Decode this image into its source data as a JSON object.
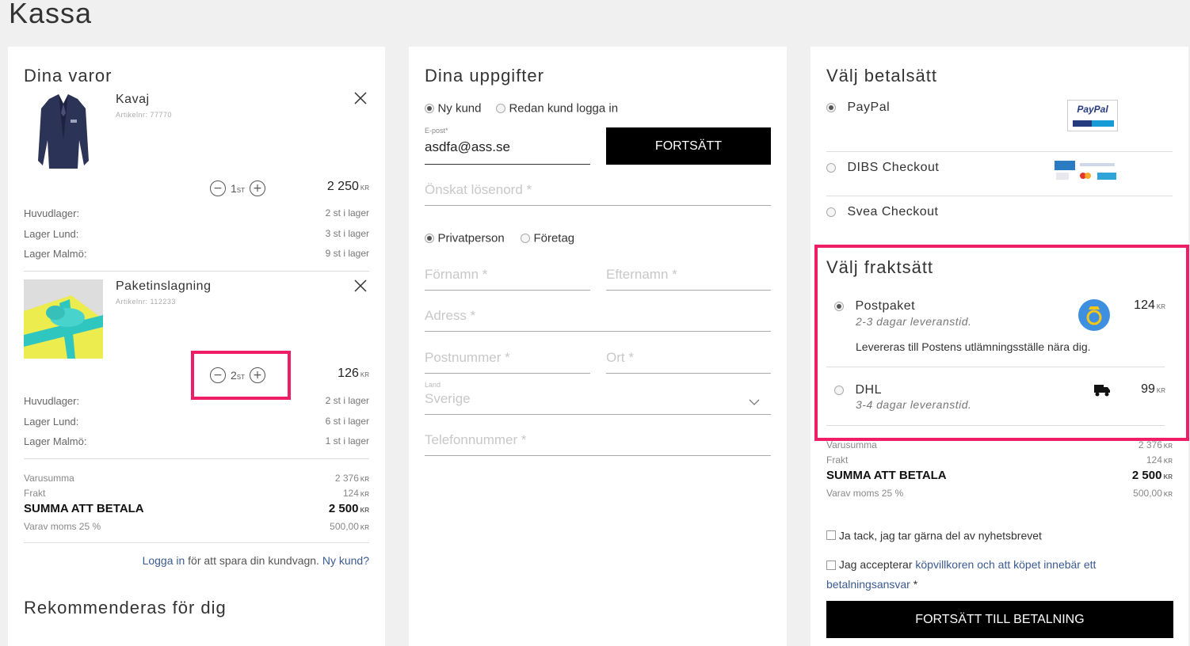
{
  "page_title": "Kassa",
  "cart": {
    "title": "Dina varor",
    "items": [
      {
        "name": "Kavaj",
        "article": "Artikelnr: 77770",
        "qty": "1",
        "qty_unit": "ST",
        "price": "2 250",
        "currency": "KR",
        "stock": [
          {
            "label": "Huvudlager:",
            "value": "2 st i lager"
          },
          {
            "label": "Lager Lund:",
            "value": "3 st i lager"
          },
          {
            "label": "Lager Malmö:",
            "value": "9 st i lager"
          }
        ]
      },
      {
        "name": "Paketinslagning",
        "article": "Artikelnr: 112233",
        "qty": "2",
        "qty_unit": "ST",
        "price": "126",
        "currency": "KR",
        "stock": [
          {
            "label": "Huvudlager:",
            "value": "2 st i lager"
          },
          {
            "label": "Lager Lund:",
            "value": "6 st i lager"
          },
          {
            "label": "Lager Malmö:",
            "value": "1 st i lager"
          }
        ]
      }
    ],
    "summary": {
      "varusumma_label": "Varusumma",
      "varusumma": "2 376",
      "frakt_label": "Frakt",
      "frakt": "124",
      "total_label": "SUMMA ATT BETALA",
      "total": "2 500",
      "moms_label": "Varav moms 25 %",
      "moms": "500,00",
      "currency": "KR"
    },
    "login_link": "Logga in",
    "login_text": "för att spara din kundvagn.",
    "new_customer_link": "Ny kund?",
    "recommended_title": "Rekommenderas för dig"
  },
  "details": {
    "title": "Dina uppgifter",
    "customer_type": [
      "Ny kund",
      "Redan kund logga in"
    ],
    "email_label": "E-post*",
    "email_value": "asdfa@ass.se",
    "continue_button": "FORTSÄTT",
    "password_placeholder": "Önskat lösenord *",
    "person_type": [
      "Privatperson",
      "Företag"
    ],
    "firstname_placeholder": "Förnamn *",
    "lastname_placeholder": "Efternamn *",
    "address_placeholder": "Adress *",
    "postal_placeholder": "Postnummer *",
    "city_placeholder": "Ort *",
    "country_label": "Land",
    "country_value": "Sverige",
    "phone_placeholder": "Telefonnummer *"
  },
  "payment": {
    "title": "Välj betalsätt",
    "methods": [
      "PayPal",
      "DIBS Checkout",
      "Svea Checkout"
    ],
    "paypal_logo_text": "PayPal",
    "shipping_title": "Välj fraktsätt",
    "shipping": [
      {
        "name": "Postpaket",
        "eta": "2-3 dagar leveranstid.",
        "price": "124",
        "note": "Levereras till Postens utlämningsställe nära dig."
      },
      {
        "name": "DHL",
        "eta": "3-4 dagar leveranstid.",
        "price": "99"
      }
    ],
    "summary": {
      "varusumma_label": "Varusumma",
      "varusumma": "2 376",
      "frakt_label": "Frakt",
      "frakt": "124",
      "total_label": "SUMMA ATT BETALA",
      "total": "2 500",
      "moms_label": "Varav moms 25 %",
      "moms": "500,00",
      "currency": "KR"
    },
    "newsletter": "Ja tack, jag tar gärna del av nyhetsbrevet",
    "terms_prefix": "Jag accepterar",
    "terms_link": "köpvillkoren och att köpet innebär ett betalningsansvar",
    "terms_suffix": "*",
    "pay_button": "FORTSÄTT TILL BETALNING"
  },
  "colors": {
    "highlight": "#ee1d65",
    "link": "#3a5a8f",
    "button": "#000000"
  }
}
